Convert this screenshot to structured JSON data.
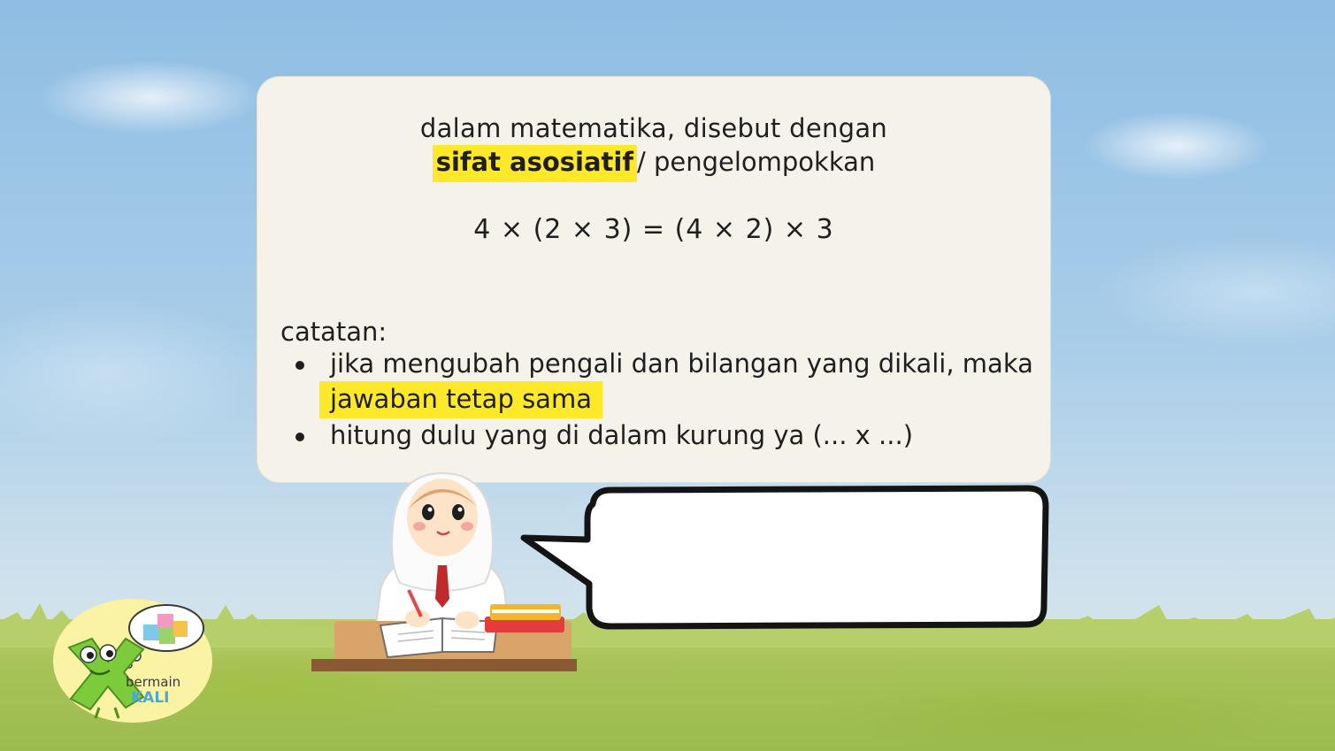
{
  "slide": {
    "line1": "dalam matematika, disebut dengan",
    "term": "sifat asosiatif",
    "line2_rest": "/ pengelompokkan",
    "equation": "4 × (2 × 3) = (4 × 2) × 3",
    "notes_heading": "catatan:",
    "bullet1_text": "jika mengubah pengali dan bilangan yang dikali, maka",
    "bullet1_highlight": "jawaban tetap sama",
    "bullet2_text": "hitung dulu yang di dalam kurung ya (... x ...)"
  },
  "speech_bubble": {
    "text": ""
  },
  "logo": {
    "line1": "bermain",
    "line2": "KALI"
  },
  "colors": {
    "highlight": "#fde829",
    "card": "#f5f2ea",
    "sky": "#9fc6e6",
    "grass": "#a7c358"
  }
}
